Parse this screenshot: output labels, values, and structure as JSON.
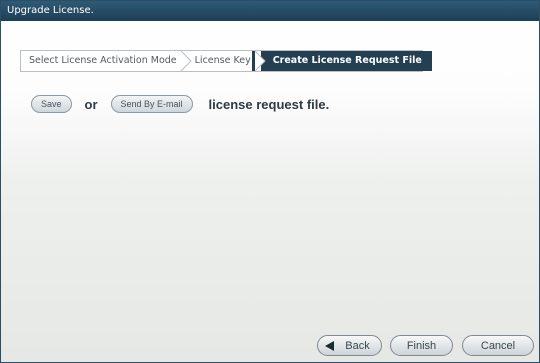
{
  "window": {
    "title": "Upgrade License."
  },
  "wizard": {
    "steps": [
      {
        "label": "Select License Activation Mode",
        "active": false
      },
      {
        "label": "License Key",
        "active": false
      },
      {
        "label": "Create License Request File",
        "active": true
      }
    ]
  },
  "content": {
    "save_label": "Save",
    "or_text": "or",
    "email_label": "Send By E-mail",
    "tail_text": "license request file."
  },
  "footer": {
    "back_label": "Back",
    "finish_label": "Finish",
    "cancel_label": "Cancel"
  },
  "colors": {
    "titlebar": "#2f5a76",
    "active_step": "#243f52",
    "button_border": "#7e8a93"
  },
  "icons": {
    "back": "back-arrow-icon",
    "step_separator": "chevron-right-icon"
  }
}
